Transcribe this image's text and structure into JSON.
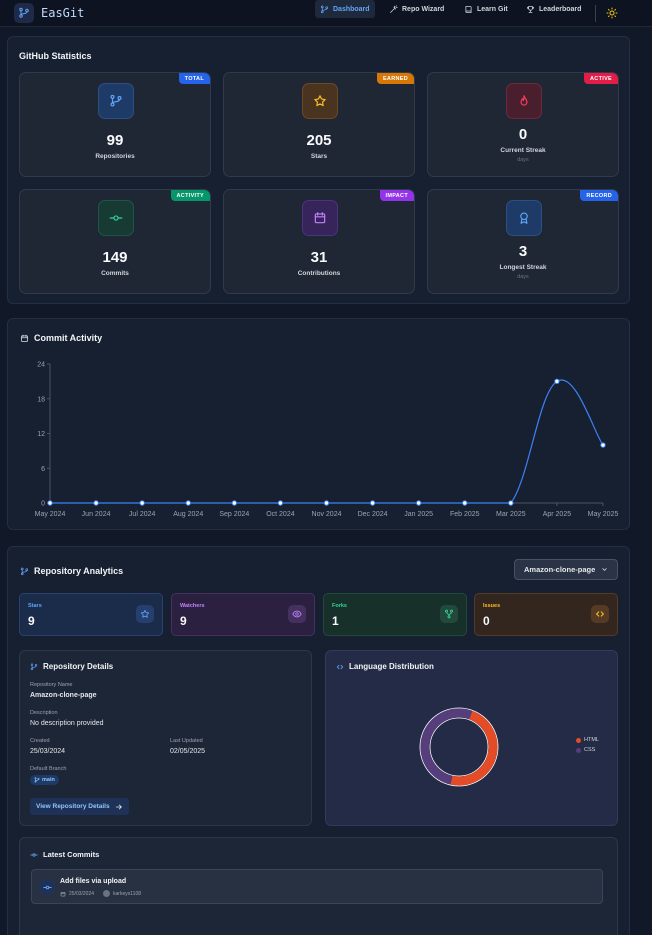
{
  "app": {
    "name": "EasGit"
  },
  "nav": {
    "links": [
      {
        "label": "Dashboard",
        "active": true
      },
      {
        "label": "Repo Wizard",
        "active": false
      },
      {
        "label": "Learn Git",
        "active": false
      },
      {
        "label": "Leaderboard",
        "active": false
      }
    ]
  },
  "stats": {
    "title": "GitHub Statistics",
    "cards": [
      {
        "badge": "TOTAL",
        "value": "99",
        "label": "Repositories",
        "sub": "",
        "icon": "git-branch-icon"
      },
      {
        "badge": "EARNED",
        "value": "205",
        "label": "Stars",
        "sub": "",
        "icon": "star-icon"
      },
      {
        "badge": "ACTIVE",
        "value": "0",
        "label": "Current Streak",
        "sub": "days",
        "icon": "flame-icon"
      },
      {
        "badge": "ACTIVITY",
        "value": "149",
        "label": "Commits",
        "sub": "",
        "icon": "commit-icon"
      },
      {
        "badge": "IMPACT",
        "value": "31",
        "label": "Contributions",
        "sub": "",
        "icon": "calendar-icon"
      },
      {
        "badge": "RECORD",
        "value": "3",
        "label": "Longest Streak",
        "sub": "days",
        "icon": "award-icon"
      }
    ]
  },
  "commit_activity": {
    "title": "Commit Activity"
  },
  "chart_data": {
    "type": "line",
    "title": "Commit Activity",
    "categories": [
      "May 2024",
      "Jun 2024",
      "Jul 2024",
      "Aug 2024",
      "Sep 2024",
      "Oct 2024",
      "Nov 2024",
      "Dec 2024",
      "Jan 2025",
      "Feb 2025",
      "Mar 2025",
      "Apr 2025",
      "May 2025"
    ],
    "series": [
      {
        "values": [
          0,
          0,
          0,
          0,
          0,
          0,
          0,
          0,
          0,
          0,
          0,
          21,
          10
        ]
      }
    ],
    "yticks": [
      0,
      6,
      12,
      18,
      24
    ],
    "ylim": [
      0,
      24
    ],
    "color": "#3b82f6"
  },
  "repo_analytics": {
    "title": "Repository Analytics",
    "selected_repo": "Amazon-clone-page",
    "metrics": [
      {
        "label": "Stars",
        "value": "9",
        "icon": "star-icon"
      },
      {
        "label": "Watchers",
        "value": "9",
        "icon": "eye-icon"
      },
      {
        "label": "Forks",
        "value": "1",
        "icon": "fork-icon"
      },
      {
        "label": "Issues",
        "value": "0",
        "icon": "code-icon"
      }
    ],
    "details": {
      "title": "Repository Details",
      "name_label": "Repository Name",
      "name": "Amazon-clone-page",
      "description_label": "Description",
      "description": "No description provided",
      "created_label": "Created",
      "created": "25/03/2024",
      "updated_label": "Last Updated",
      "updated": "02/05/2025",
      "branch_label": "Default Branch",
      "branch": "main",
      "view_button": "View Repository Details"
    },
    "languages": {
      "title": "Language Distribution",
      "items": [
        {
          "name": "HTML",
          "share": 0.48,
          "color": "#e34c26"
        },
        {
          "name": "CSS",
          "share": 0.52,
          "color": "#563d7c"
        }
      ]
    },
    "latest_commits": {
      "title": "Latest Commits",
      "items": [
        {
          "message": "Add files via upload",
          "date": "25/03/2024",
          "author": "karkeys1108"
        }
      ]
    }
  }
}
